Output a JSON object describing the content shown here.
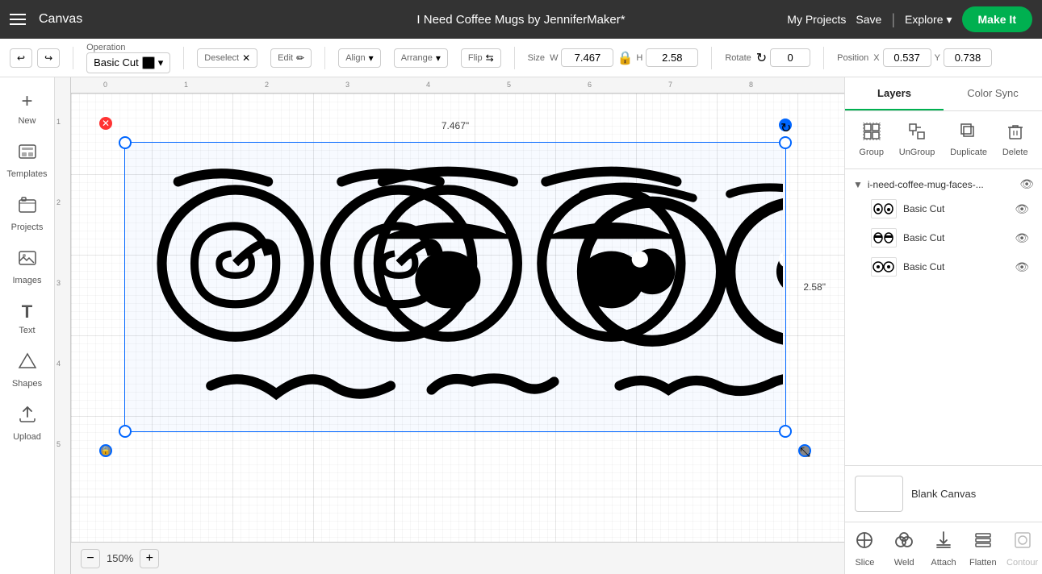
{
  "navbar": {
    "title": "Canvas",
    "project_title": "I Need Coffee Mugs by JenniferMaker*",
    "my_projects": "My Projects",
    "save": "Save",
    "explore": "Explore",
    "make_it": "Make It"
  },
  "toolbar": {
    "operation_label": "Operation",
    "operation_value": "Basic Cut",
    "deselect_label": "Deselect",
    "edit_label": "Edit",
    "align_label": "Align",
    "arrange_label": "Arrange",
    "flip_label": "Flip",
    "size_label": "Size",
    "width_label": "W",
    "width_value": "7.467",
    "height_label": "H",
    "height_value": "2.58",
    "rotate_label": "Rotate",
    "rotate_value": "0",
    "position_label": "Position",
    "x_label": "X",
    "x_value": "0.537",
    "y_label": "Y",
    "y_value": "0.738"
  },
  "sidebar": {
    "items": [
      {
        "id": "new",
        "label": "New",
        "icon": "+"
      },
      {
        "id": "templates",
        "label": "Templates",
        "icon": "👕"
      },
      {
        "id": "projects",
        "label": "Projects",
        "icon": "🗂"
      },
      {
        "id": "images",
        "label": "Images",
        "icon": "🖼"
      },
      {
        "id": "text",
        "label": "Text",
        "icon": "T"
      },
      {
        "id": "shapes",
        "label": "Shapes",
        "icon": "◇"
      },
      {
        "id": "upload",
        "label": "Upload",
        "icon": "⬆"
      }
    ]
  },
  "canvas": {
    "zoom": "150%",
    "width_label": "7.467\"",
    "height_label": "2.58\"",
    "ruler_marks": [
      "0",
      "1",
      "2",
      "3",
      "4",
      "5",
      "6",
      "7",
      "8"
    ]
  },
  "right_panel": {
    "tabs": [
      "Layers",
      "Color Sync"
    ],
    "active_tab": "Layers",
    "actions": [
      {
        "id": "group",
        "label": "Group",
        "enabled": true
      },
      {
        "id": "ungroup",
        "label": "UnGroup",
        "enabled": true
      },
      {
        "id": "duplicate",
        "label": "Duplicate",
        "enabled": true
      },
      {
        "id": "delete",
        "label": "Delete",
        "enabled": true
      }
    ],
    "layer_group": {
      "name": "i-need-coffee-mug-faces-...",
      "visible": true,
      "layers": [
        {
          "id": 1,
          "name": "Basic Cut",
          "visible": true
        },
        {
          "id": 2,
          "name": "Basic Cut",
          "visible": true
        },
        {
          "id": 3,
          "name": "Basic Cut",
          "visible": true
        }
      ]
    },
    "blank_canvas_label": "Blank Canvas"
  },
  "bottom_actions": {
    "items": [
      {
        "id": "slice",
        "label": "Slice",
        "enabled": true
      },
      {
        "id": "weld",
        "label": "Weld",
        "enabled": true
      },
      {
        "id": "attach",
        "label": "Attach",
        "enabled": true
      },
      {
        "id": "flatten",
        "label": "Flatten",
        "enabled": true
      },
      {
        "id": "contour",
        "label": "Contour",
        "enabled": false
      }
    ]
  },
  "colors": {
    "green": "#00b050",
    "dark": "#333",
    "selection_blue": "#0066ff"
  }
}
